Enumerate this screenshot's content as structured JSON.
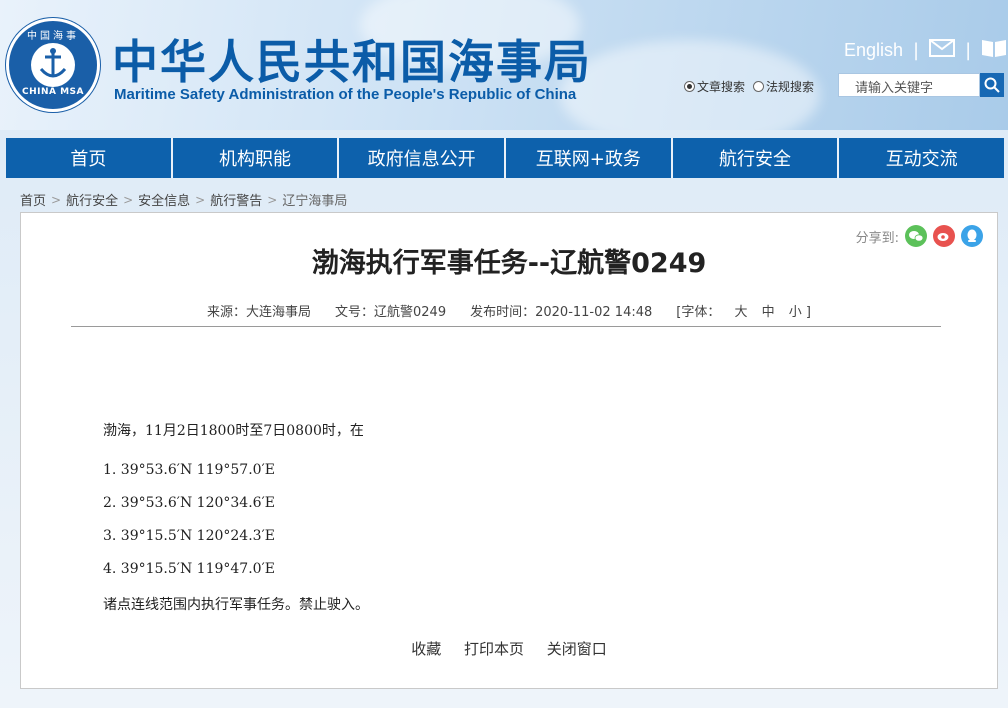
{
  "header": {
    "logo_text_top": "中国海事",
    "logo_text_bottom": "CHINA MSA",
    "title_cn": "中华人民共和国海事局",
    "title_en": "Maritime Safety Administration of the People's Republic of China",
    "english_link": "English",
    "mail_icon": "mail-icon",
    "book_icon": "book-icon",
    "search": {
      "option_article": "文章搜索",
      "option_regulation": "法规搜索",
      "selected": "文章搜索",
      "placeholder": "请输入关键字"
    }
  },
  "nav": {
    "items": [
      "首页",
      "机构职能",
      "政府信息公开",
      "互联网+政务",
      "航行安全",
      "互动交流"
    ]
  },
  "breadcrumb": [
    "首页",
    "航行安全",
    "安全信息",
    "航行警告",
    "辽宁海事局"
  ],
  "article": {
    "share_label": "分享到:",
    "title": "渤海执行军事任务--辽航警0249",
    "meta": {
      "source": "来源：大连海事局",
      "doc_no": "文号：辽航警0249",
      "publish_time": "发布时间：2020-11-02 14:48",
      "font_label": "[字体：",
      "font_large": "大",
      "font_medium": "中",
      "font_small": "小 ]"
    },
    "body": {
      "intro": "渤海，11月2日1800时至7日0800时，在",
      "points": [
        "1. 39°53.6′N  119°57.0′E",
        "2. 39°53.6′N  120°34.6′E",
        "3. 39°15.5′N  120°24.3′E",
        "4. 39°15.5′N  119°47.0′E"
      ],
      "closing": "诸点连线范围内执行军事任务。禁止驶入。"
    },
    "footer": {
      "favorite": "收藏",
      "print": "打印本页",
      "close": "关闭窗口"
    }
  },
  "colors": {
    "brand_blue": "#0d61ac",
    "title_blue": "#0b5ca8"
  }
}
